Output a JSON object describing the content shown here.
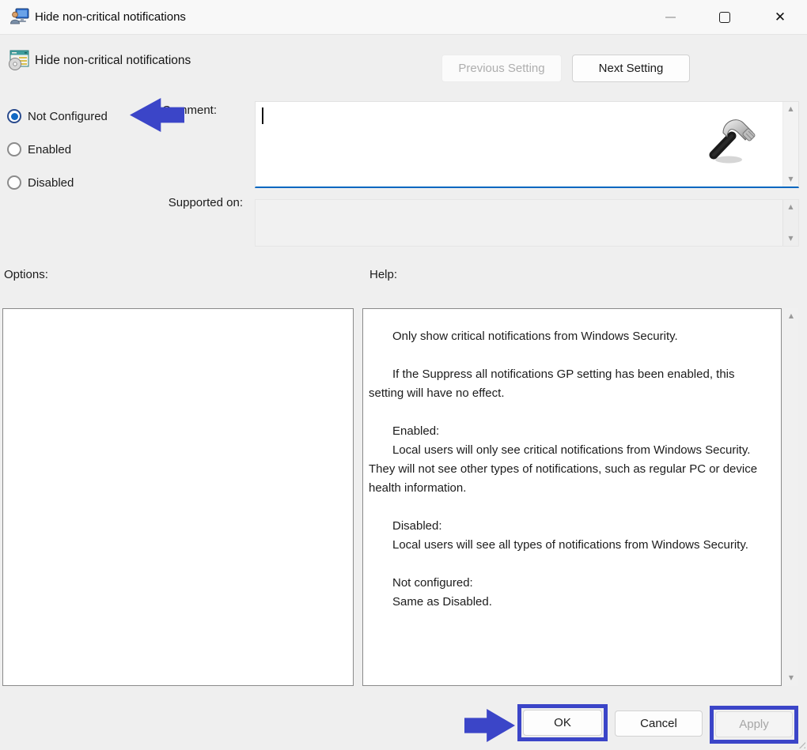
{
  "window": {
    "title": "Hide non-critical notifications",
    "controls": {
      "minimize": {
        "name": "minimize",
        "enabled": false
      },
      "maximize": {
        "name": "maximize",
        "enabled": true
      },
      "close": {
        "name": "close",
        "enabled": true
      }
    }
  },
  "header": {
    "setting_title": "Hide non-critical notifications",
    "previous_button": {
      "label": "Previous Setting",
      "enabled": false
    },
    "next_button": {
      "label": "Next Setting",
      "enabled": true
    }
  },
  "configuration": {
    "options": [
      {
        "label": "Not Configured",
        "selected": true
      },
      {
        "label": "Enabled",
        "selected": false
      },
      {
        "label": "Disabled",
        "selected": false
      }
    ]
  },
  "comment": {
    "label": "Comment:",
    "value": "",
    "focused": true
  },
  "supported_on": {
    "label": "Supported on:",
    "value": "",
    "enabled": false
  },
  "options_panel": {
    "label": "Options:",
    "content": ""
  },
  "help_panel": {
    "label": "Help:",
    "paragraphs": [
      "Only show critical notifications from Windows Security.",
      "",
      "If the Suppress all notifications GP setting has been enabled, this setting will have no effect.",
      "",
      "Enabled:",
      "Local users will only see critical notifications from Windows Security. They will not see other types of notifications, such as regular PC or device health information.",
      "",
      "Disabled:",
      "Local users will see all types of notifications from Windows Security.",
      "",
      "Not configured:",
      "Same as Disabled."
    ]
  },
  "footer": {
    "ok_label": "OK",
    "cancel_label": "Cancel",
    "apply_label": "Apply",
    "apply_enabled": false
  },
  "annotations": {
    "color": "#3b45c8",
    "arrow_left_target": "Not Configured radio",
    "arrow_right_target": "OK button",
    "highlighted_buttons": [
      "OK",
      "Apply"
    ]
  },
  "colors": {
    "accent_focus_underline": "#0067c0",
    "annotation_blue": "#3b45c8"
  },
  "icons": {
    "app_icon": "group-policy-computer-user",
    "setting_icon": "policy-setting-window-disc",
    "cursor_icon": "hammer-cursor",
    "scroll_up_glyph": "▲",
    "scroll_down_glyph": "▼",
    "close_glyph": "✕"
  }
}
